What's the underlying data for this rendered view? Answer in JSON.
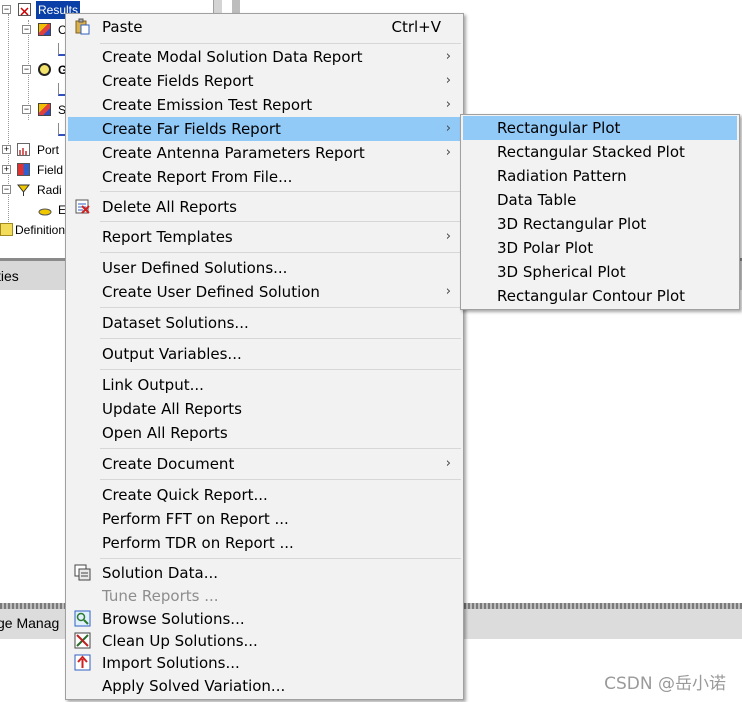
{
  "tree": {
    "items": [
      {
        "label": "Results",
        "selected": true
      },
      {
        "label": "C"
      },
      {
        "label": ""
      },
      {
        "label": "G"
      },
      {
        "label": ""
      },
      {
        "label": "S"
      },
      {
        "label": ""
      },
      {
        "label": "Port"
      },
      {
        "label": "Field"
      },
      {
        "label": "Radi"
      },
      {
        "label": "E"
      },
      {
        "label": "Definition"
      }
    ]
  },
  "panels": {
    "properties_label": "ties",
    "message_label": "ge Manag"
  },
  "menu": {
    "items": [
      {
        "label": "Paste",
        "shortcut": "Ctrl+V",
        "icon": "paste-icon"
      },
      {
        "label": "Create Modal Solution Data Report",
        "submenu": true
      },
      {
        "label": "Create Fields Report",
        "submenu": true
      },
      {
        "label": "Create Emission Test Report",
        "submenu": true
      },
      {
        "label": "Create Far Fields Report",
        "submenu": true,
        "highlighted": true
      },
      {
        "label": "Create Antenna Parameters Report",
        "submenu": true
      },
      {
        "label": "Create Report From File..."
      },
      {
        "label": "Delete All Reports",
        "icon": "delete-reports-icon"
      },
      {
        "label": "Report Templates",
        "submenu": true
      },
      {
        "label": "User Defined Solutions..."
      },
      {
        "label": "Create User Defined Solution",
        "submenu": true
      },
      {
        "label": "Dataset Solutions..."
      },
      {
        "label": "Output Variables..."
      },
      {
        "label": "Link Output..."
      },
      {
        "label": "Update All Reports"
      },
      {
        "label": "Open All Reports"
      },
      {
        "label": "Create Document",
        "submenu": true
      },
      {
        "label": "Create Quick Report..."
      },
      {
        "label": "Perform FFT on Report ..."
      },
      {
        "label": "Perform TDR on Report ..."
      },
      {
        "label": "Solution Data...",
        "icon": "solution-data-icon"
      },
      {
        "label": "Tune Reports ...",
        "disabled": true
      },
      {
        "label": "Browse Solutions...",
        "icon": "browse-solutions-icon"
      },
      {
        "label": "Clean Up Solutions...",
        "icon": "clean-up-icon"
      },
      {
        "label": "Import Solutions...",
        "icon": "import-icon"
      },
      {
        "label": "Apply Solved Variation..."
      }
    ]
  },
  "submenu": {
    "items": [
      {
        "label": "Rectangular Plot",
        "highlighted": true
      },
      {
        "label": "Rectangular Stacked Plot"
      },
      {
        "label": "Radiation Pattern"
      },
      {
        "label": "Data Table"
      },
      {
        "label": "3D Rectangular Plot"
      },
      {
        "label": "3D Polar Plot"
      },
      {
        "label": "3D Spherical Plot"
      },
      {
        "label": "Rectangular Contour Plot"
      }
    ]
  },
  "watermark": "CSDN @岳小诺",
  "colors": {
    "highlight": "#91c9f7",
    "menu_bg": "#f2f2f2",
    "tree_select": "#0a3fa8"
  }
}
